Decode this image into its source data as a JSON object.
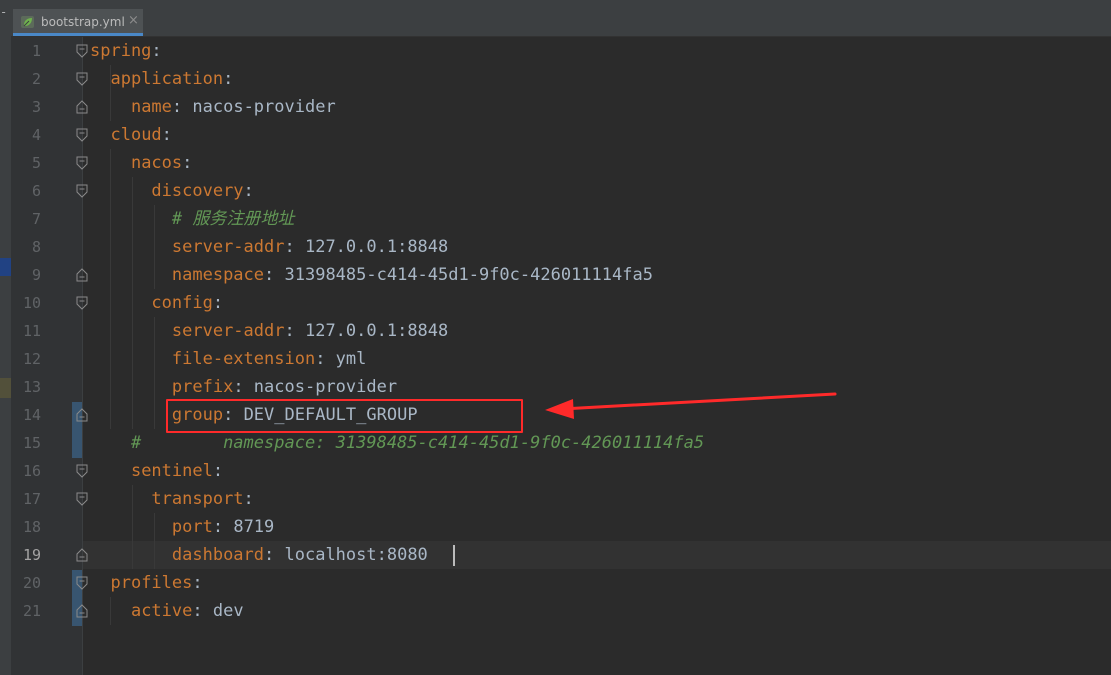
{
  "tab": {
    "label": "bootstrap.yml",
    "close": "×"
  },
  "current_line": 19,
  "lines": [
    {
      "num": "1",
      "indent": "",
      "key": "spring",
      "sep": ":",
      "value": ""
    },
    {
      "num": "2",
      "indent": "  ",
      "key": "application",
      "sep": ":",
      "value": ""
    },
    {
      "num": "3",
      "indent": "    ",
      "key": "name",
      "sep": ":",
      "value": " nacos-provider"
    },
    {
      "num": "4",
      "indent": "  ",
      "key": "cloud",
      "sep": ":",
      "value": ""
    },
    {
      "num": "5",
      "indent": "    ",
      "key": "nacos",
      "sep": ":",
      "value": ""
    },
    {
      "num": "6",
      "indent": "      ",
      "key": "discovery",
      "sep": ":",
      "value": ""
    },
    {
      "num": "7",
      "indent": "        ",
      "comment": "# 服务注册地址"
    },
    {
      "num": "8",
      "indent": "        ",
      "key": "server-addr",
      "sep": ":",
      "value": " 127.0.0.1:8848"
    },
    {
      "num": "9",
      "indent": "        ",
      "key": "namespace",
      "sep": ":",
      "value": " 31398485-c414-45d1-9f0c-426011114fa5"
    },
    {
      "num": "10",
      "indent": "      ",
      "key": "config",
      "sep": ":",
      "value": ""
    },
    {
      "num": "11",
      "indent": "        ",
      "key": "server-addr",
      "sep": ":",
      "value": " 127.0.0.1:8848"
    },
    {
      "num": "12",
      "indent": "        ",
      "key": "file-extension",
      "sep": ":",
      "value": " yml"
    },
    {
      "num": "13",
      "indent": "        ",
      "key": "prefix",
      "sep": ":",
      "value": " nacos-provider"
    },
    {
      "num": "14",
      "indent": "        ",
      "key": "group",
      "sep": ":",
      "value": " DEV_DEFAULT_GROUP"
    },
    {
      "num": "15",
      "indent": "    ",
      "comment": "#        namespace: 31398485-c414-45d1-9f0c-426011114fa5"
    },
    {
      "num": "16",
      "indent": "    ",
      "key": "sentinel",
      "sep": ":",
      "value": ""
    },
    {
      "num": "17",
      "indent": "      ",
      "key": "transport",
      "sep": ":",
      "value": ""
    },
    {
      "num": "18",
      "indent": "        ",
      "key": "port",
      "sep": ":",
      "value": " 8719"
    },
    {
      "num": "19",
      "indent": "        ",
      "key": "dashboard",
      "sep": ":",
      "value": " localhost:8080"
    },
    {
      "num": "20",
      "indent": "  ",
      "key": "profiles",
      "sep": ":",
      "value": ""
    },
    {
      "num": "21",
      "indent": "    ",
      "key": "active",
      "sep": ":",
      "value": " dev"
    }
  ],
  "colors": {
    "background": "#2b2b2b",
    "gutter": "#313335",
    "key": "#cc7832",
    "value": "#a9b7c6",
    "comment": "#629755",
    "annotation": "#ff2a2a"
  },
  "icons": {
    "file": "spring-leaf-icon"
  }
}
